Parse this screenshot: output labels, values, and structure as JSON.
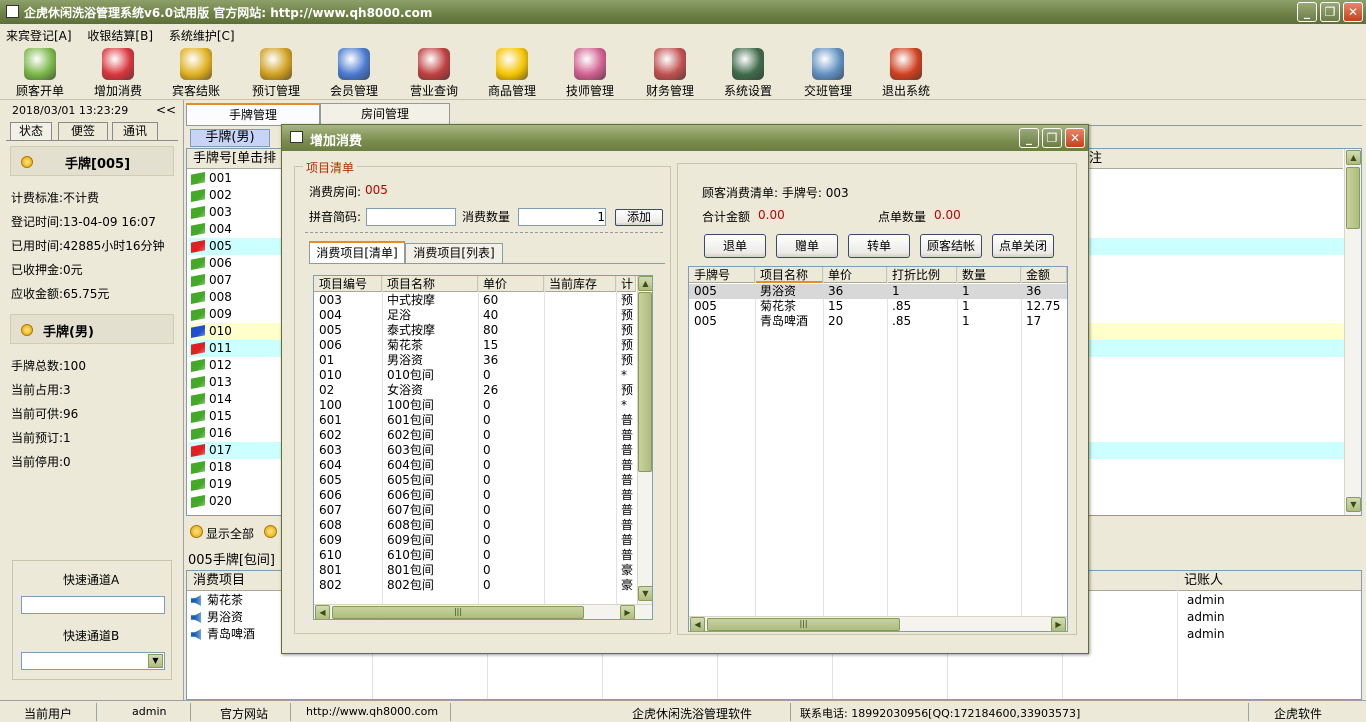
{
  "window": {
    "title": "企虎休闲洗浴管理系统v6.0试用版   官方网站: http://www.qh8000.com",
    "minimize": "_",
    "maximize": "❐",
    "close": "✕"
  },
  "menu": [
    "来宾登记[A]",
    "收银结算[B]",
    "系统维护[C]"
  ],
  "toolbar": [
    {
      "label": "顾客开单",
      "icon": "customer-icon",
      "color": "#7ab648"
    },
    {
      "label": "增加消费",
      "icon": "add-consume-icon",
      "color": "#d9363e"
    },
    {
      "label": "宾客结账",
      "icon": "checkout-icon",
      "color": "#e0b020"
    },
    {
      "label": "预订管理",
      "icon": "alarm-clock-icon",
      "color": "#d0a020"
    },
    {
      "label": "会员管理",
      "icon": "members-icon",
      "color": "#4a7ad0"
    },
    {
      "label": "营业查询",
      "icon": "query-icon",
      "color": "#c04040"
    },
    {
      "label": "商品管理",
      "icon": "star-icon",
      "color": "#f5c400"
    },
    {
      "label": "技师管理",
      "icon": "technician-icon",
      "color": "#d06090"
    },
    {
      "label": "财务管理",
      "icon": "finance-icon",
      "color": "#c05050"
    },
    {
      "label": "系统设置",
      "icon": "settings-book-icon",
      "color": "#3f6a4a"
    },
    {
      "label": "交班管理",
      "icon": "handshake-icon",
      "color": "#6090c0"
    },
    {
      "label": "退出系统",
      "icon": "exit-door-icon",
      "color": "#d04020"
    }
  ],
  "left": {
    "datetime": "2018/03/01  13:23:29",
    "collapse": "<<",
    "tabs": [
      "状态",
      "便签",
      "通讯"
    ],
    "card_section": {
      "title": "手牌[005]",
      "lines": [
        "计费标准:不计费",
        "登记时间:13-04-09 16:07",
        "已用时间:42885小时16分钟",
        "已收押金:0元",
        "应收金额:65.75元"
      ]
    },
    "type_section": {
      "title": "手牌(男)",
      "lines": [
        "手牌总数:100",
        "当前占用:3",
        "当前可供:96",
        "当前预订:1",
        "当前停用:0"
      ]
    },
    "quick_a": "快速通道A",
    "quick_b": "快速通道B",
    "dropdown_arrow": "▼"
  },
  "center": {
    "tabs": [
      "手牌管理",
      "房间管理"
    ],
    "subtab": "手牌(男)",
    "grid_header": "手牌号[单击排",
    "grid_header_right": "注",
    "rows": [
      {
        "no": "001",
        "state": "free"
      },
      {
        "no": "002",
        "state": "free"
      },
      {
        "no": "003",
        "state": "free"
      },
      {
        "no": "004",
        "state": "free"
      },
      {
        "no": "005",
        "state": "used"
      },
      {
        "no": "006",
        "state": "free"
      },
      {
        "no": "007",
        "state": "free"
      },
      {
        "no": "008",
        "state": "free"
      },
      {
        "no": "009",
        "state": "free"
      },
      {
        "no": "010",
        "state": "reserved"
      },
      {
        "no": "011",
        "state": "used"
      },
      {
        "no": "012",
        "state": "free"
      },
      {
        "no": "013",
        "state": "free"
      },
      {
        "no": "014",
        "state": "free"
      },
      {
        "no": "015",
        "state": "free"
      },
      {
        "no": "016",
        "state": "free"
      },
      {
        "no": "017",
        "state": "used"
      },
      {
        "no": "018",
        "state": "free"
      },
      {
        "no": "019",
        "state": "free"
      },
      {
        "no": "020",
        "state": "free"
      }
    ],
    "show_all": "显示全部",
    "detail_label": "005手牌[包间]",
    "bottom_header": "消费项目",
    "bottom_header_right": "记账人",
    "bottom_rows": [
      {
        "item": "菊花茶",
        "user": "admin"
      },
      {
        "item": "男浴资",
        "user": "admin"
      },
      {
        "item": "青岛啤酒",
        "user": "admin"
      }
    ]
  },
  "dialog": {
    "title": "增加消费",
    "group_title": "项目清单",
    "room_label": "消费房间:",
    "room_value": "005",
    "pinyin_label": "拼音简码:",
    "pinyin_value": "",
    "qty_label": "消费数量",
    "qty_value": "1",
    "add_button": "添加",
    "tabs": [
      "消费项目[清单]",
      "消费项目[列表]"
    ],
    "items_columns": [
      "项目编号",
      "项目名称",
      "单价",
      "当前库存",
      "计"
    ],
    "items": [
      [
        "003",
        "中式按摩",
        "60",
        "",
        "预"
      ],
      [
        "004",
        "足浴",
        "40",
        "",
        "预"
      ],
      [
        "005",
        "泰式按摩",
        "80",
        "",
        "预"
      ],
      [
        "006",
        "菊花茶",
        "15",
        "",
        "预"
      ],
      [
        "01",
        "男浴资",
        "36",
        "",
        "预"
      ],
      [
        "010",
        "010包间",
        "0",
        "",
        "*"
      ],
      [
        "02",
        "女浴资",
        "26",
        "",
        "预"
      ],
      [
        "100",
        "100包间",
        "0",
        "",
        "*"
      ],
      [
        "601",
        "601包间",
        "0",
        "",
        "普"
      ],
      [
        "602",
        "602包间",
        "0",
        "",
        "普"
      ],
      [
        "603",
        "603包间",
        "0",
        "",
        "普"
      ],
      [
        "604",
        "604包间",
        "0",
        "",
        "普"
      ],
      [
        "605",
        "605包间",
        "0",
        "",
        "普"
      ],
      [
        "606",
        "606包间",
        "0",
        "",
        "普"
      ],
      [
        "607",
        "607包间",
        "0",
        "",
        "普"
      ],
      [
        "608",
        "608包间",
        "0",
        "",
        "普"
      ],
      [
        "609",
        "609包间",
        "0",
        "",
        "普"
      ],
      [
        "610",
        "610包间",
        "0",
        "",
        "普"
      ],
      [
        "801",
        "801包间",
        "0",
        "",
        "豪"
      ],
      [
        "802",
        "802包间",
        "0",
        "",
        "豪"
      ]
    ],
    "order_title": "顾客消费清单: 手牌号: 003",
    "total_label": "合计金额",
    "total_value": "0.00",
    "count_label": "点单数量",
    "count_value": "0.00",
    "buttons": [
      "退单",
      "赠单",
      "转单",
      "顾客结帐",
      "点单关闭"
    ],
    "order_columns": [
      "手牌号",
      "项目名称",
      "单价",
      "打折比例",
      "数量",
      "金额"
    ],
    "orders": [
      [
        "005",
        "男浴资",
        "36",
        "1",
        "1",
        "36"
      ],
      [
        "005",
        "菊花茶",
        "15",
        ".85",
        "1",
        "12.75"
      ],
      [
        "005",
        "青岛啤酒",
        "20",
        ".85",
        "1",
        "17"
      ]
    ],
    "scroll_grip": "|||"
  },
  "status": {
    "user_label": "当前用户",
    "user": "admin",
    "site_label": "官方网站",
    "site": "http://www.qh8000.com",
    "product": "企虎休闲洗浴管理软件",
    "phone": "联系电话: 18992030956[QQ:172184600,33903573]",
    "brand": "企虎软件"
  },
  "colors": {
    "free": "#44a828",
    "used": "#e02020",
    "reserved": "#2050d0",
    "row_cyan": "#ccffff",
    "row_yellow": "#ffffcc",
    "money_red": "#c00000"
  }
}
